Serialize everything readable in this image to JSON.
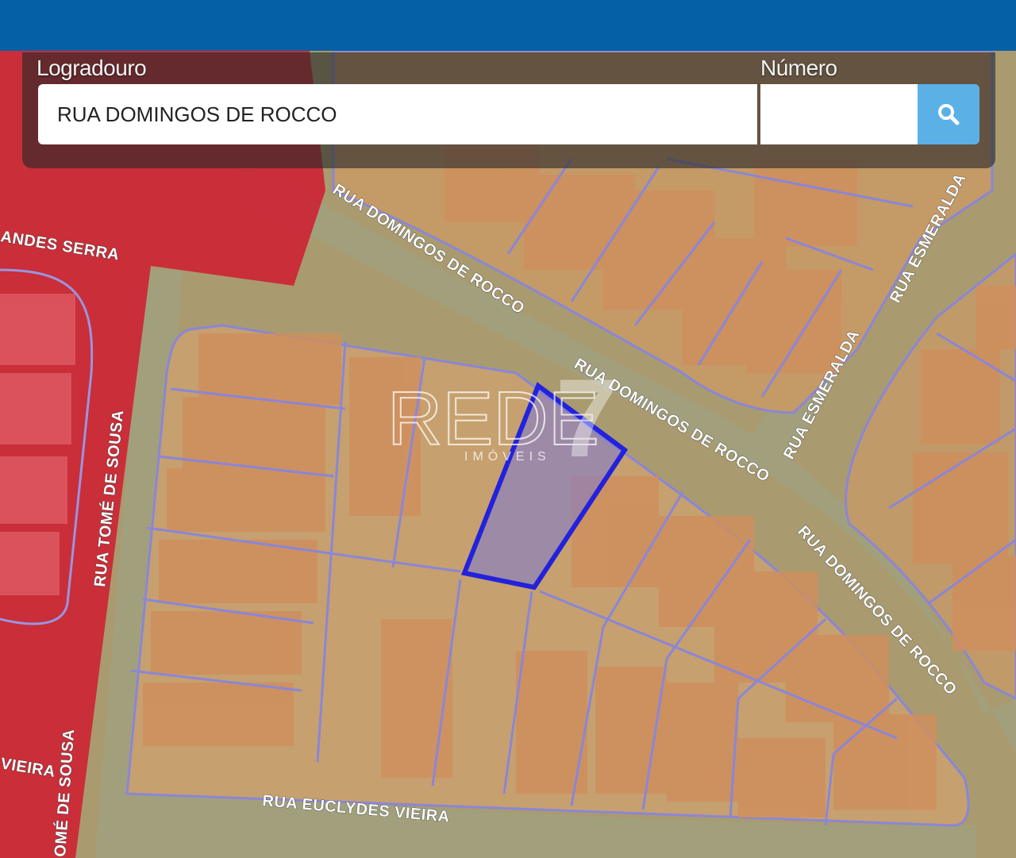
{
  "search": {
    "street_label": "Logradouro",
    "street_value": "RUA DOMINGOS DE ROCCO",
    "number_label": "Número",
    "number_value": "",
    "button_icon": "search-icon"
  },
  "map": {
    "street_labels": [
      "RUA DOMINGOS DE ROCCO",
      "RUA DOMINGOS DE ROCCO",
      "RUA DOMINGOS DE ROCCO",
      "RUA ESMERALDA",
      "RUA ESMERALDA",
      "RUA TOMÉ DE SOUSA",
      "RUA EUCLYDES VIEIRA",
      "ANDES SERRA",
      "VIEIRA",
      "OMÉ DE SOUSA"
    ],
    "selected_parcel_color": "#2222dd",
    "zone_color": "#cc2233",
    "parcel_line_color": "#8a86d8"
  },
  "watermark": {
    "brand": "REDE",
    "mark": "7",
    "sub": "IMÓVEIS"
  },
  "colors": {
    "topbar": "#0660a6",
    "search_button": "#5bb0e6"
  }
}
